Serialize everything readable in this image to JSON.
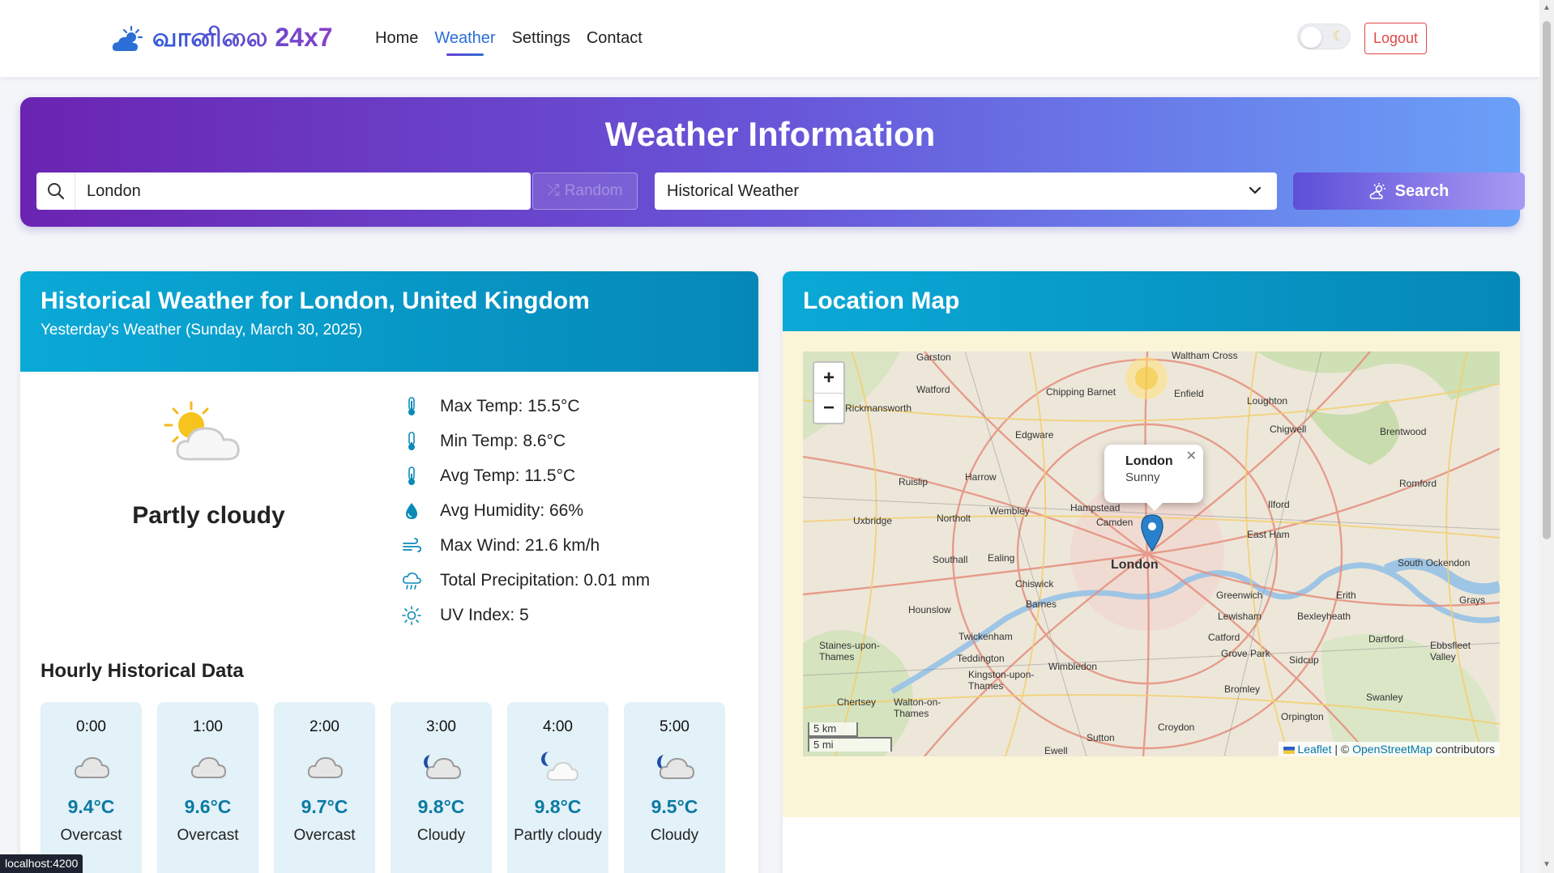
{
  "nav": {
    "brand": "வானிலை 24x7",
    "links": [
      "Home",
      "Weather",
      "Settings",
      "Contact"
    ],
    "active": "Weather",
    "logout": "Logout"
  },
  "hero": {
    "title": "Weather Information",
    "search_value": "London",
    "random_label": "Random",
    "select_value": "Historical Weather",
    "search_button": "Search"
  },
  "weather": {
    "title": "Historical Weather for London, United Kingdom",
    "subtitle": "Yesterday's Weather (Sunday, March 30, 2025)",
    "condition": "Partly cloudy",
    "stats": [
      {
        "icon": "thermometer-high-icon",
        "text": "Max Temp: 15.5°C"
      },
      {
        "icon": "thermometer-low-icon",
        "text": "Min Temp: 8.6°C"
      },
      {
        "icon": "thermometer-half-icon",
        "text": "Avg Temp: 11.5°C"
      },
      {
        "icon": "droplet-icon",
        "text": "Avg Humidity: 66%"
      },
      {
        "icon": "wind-icon",
        "text": "Max Wind: 21.6 km/h"
      },
      {
        "icon": "cloud-rain-icon",
        "text": "Total Precipitation: 0.01 mm"
      },
      {
        "icon": "sun-icon",
        "text": "UV Index: 5"
      }
    ],
    "hourly_title": "Hourly Historical Data",
    "hourly": [
      {
        "time": "0:00",
        "icon": "overcast-icon",
        "temp": "9.4°C",
        "cond": "Overcast"
      },
      {
        "time": "1:00",
        "icon": "overcast-icon",
        "temp": "9.6°C",
        "cond": "Overcast"
      },
      {
        "time": "2:00",
        "icon": "overcast-icon",
        "temp": "9.7°C",
        "cond": "Overcast"
      },
      {
        "time": "3:00",
        "icon": "cloudy-night-icon",
        "temp": "9.8°C",
        "cond": "Cloudy"
      },
      {
        "time": "4:00",
        "icon": "partly-cloudy-night-icon",
        "temp": "9.8°C",
        "cond": "Partly cloudy"
      },
      {
        "time": "5:00",
        "icon": "cloudy-night-icon",
        "temp": "9.5°C",
        "cond": "Cloudy"
      }
    ]
  },
  "map": {
    "title": "Location Map",
    "popup_city": "London",
    "popup_condition": "Sunny",
    "scale_km": "5 km",
    "scale_mi": "5 mi",
    "attr_leaflet": "Leaflet",
    "attr_sep": " | © ",
    "attr_osm": "OpenStreetMap",
    "attr_tail": " contributors",
    "labels": [
      "Garston",
      "Waltham Cross",
      "Watford",
      "Chipping Barnet",
      "Enfield",
      "Loughton",
      "Rickmansworth",
      "Chigwell",
      "Brentwood",
      "Edgware",
      "London",
      "Romford",
      "Ruislip",
      "Harrow",
      "Wembley",
      "Hampstead",
      "Camden",
      "Ilford",
      "Uxbridge",
      "Northolt",
      "East Ham",
      "Southall",
      "Ealing",
      "Chiswick",
      "Barnes",
      "Greenwich",
      "Erith",
      "Hounslow",
      "Lewisham",
      "Bexleyheath",
      "Twickenham",
      "Catford",
      "Dartford",
      "Staines-upon-Thames",
      "Teddington",
      "Grove Park",
      "Sidcup",
      "Kingston-upon-Thames",
      "Wimbledon",
      "Bromley",
      "Chertsey",
      "Walton-on-Thames",
      "Swanley",
      "Orpington",
      "Croydon",
      "Sutton",
      "Ewell",
      "Grays",
      "South Ockendon",
      "Ebbsfleet Valley"
    ]
  },
  "status_url": "localhost:4200"
}
